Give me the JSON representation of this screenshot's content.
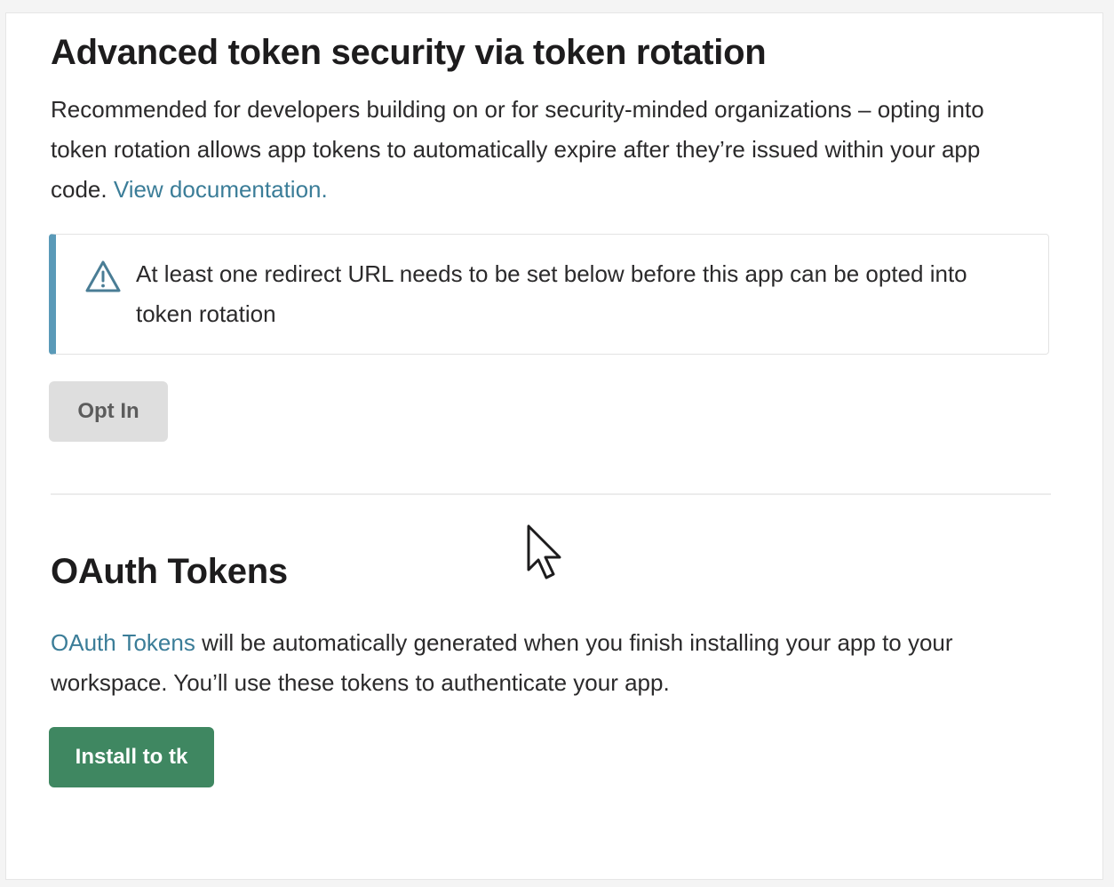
{
  "token_rotation": {
    "title": "Advanced token security via token rotation",
    "description": "Recommended for developers building on or for security-minded organizations – opting into token rotation allows app tokens to automatically expire after they’re issued within your app code. ",
    "doc_link": "View documentation.",
    "warning": {
      "icon": "warning-icon",
      "text": "At least one redirect URL needs to be set below before this app can be opted into token rotation",
      "accent_color": "#5a9ab8"
    },
    "opt_in_label": "Opt In"
  },
  "oauth_tokens": {
    "title": "OAuth Tokens",
    "link_text": "OAuth Tokens",
    "description": " will be automatically generated when you finish installing your app to your workspace. You’ll use these tokens to authenticate your app.",
    "install_label": "Install to tk",
    "install_color": "#3f8761"
  },
  "colors": {
    "link": "#3b7d98",
    "disabled_button": "#dedede"
  }
}
